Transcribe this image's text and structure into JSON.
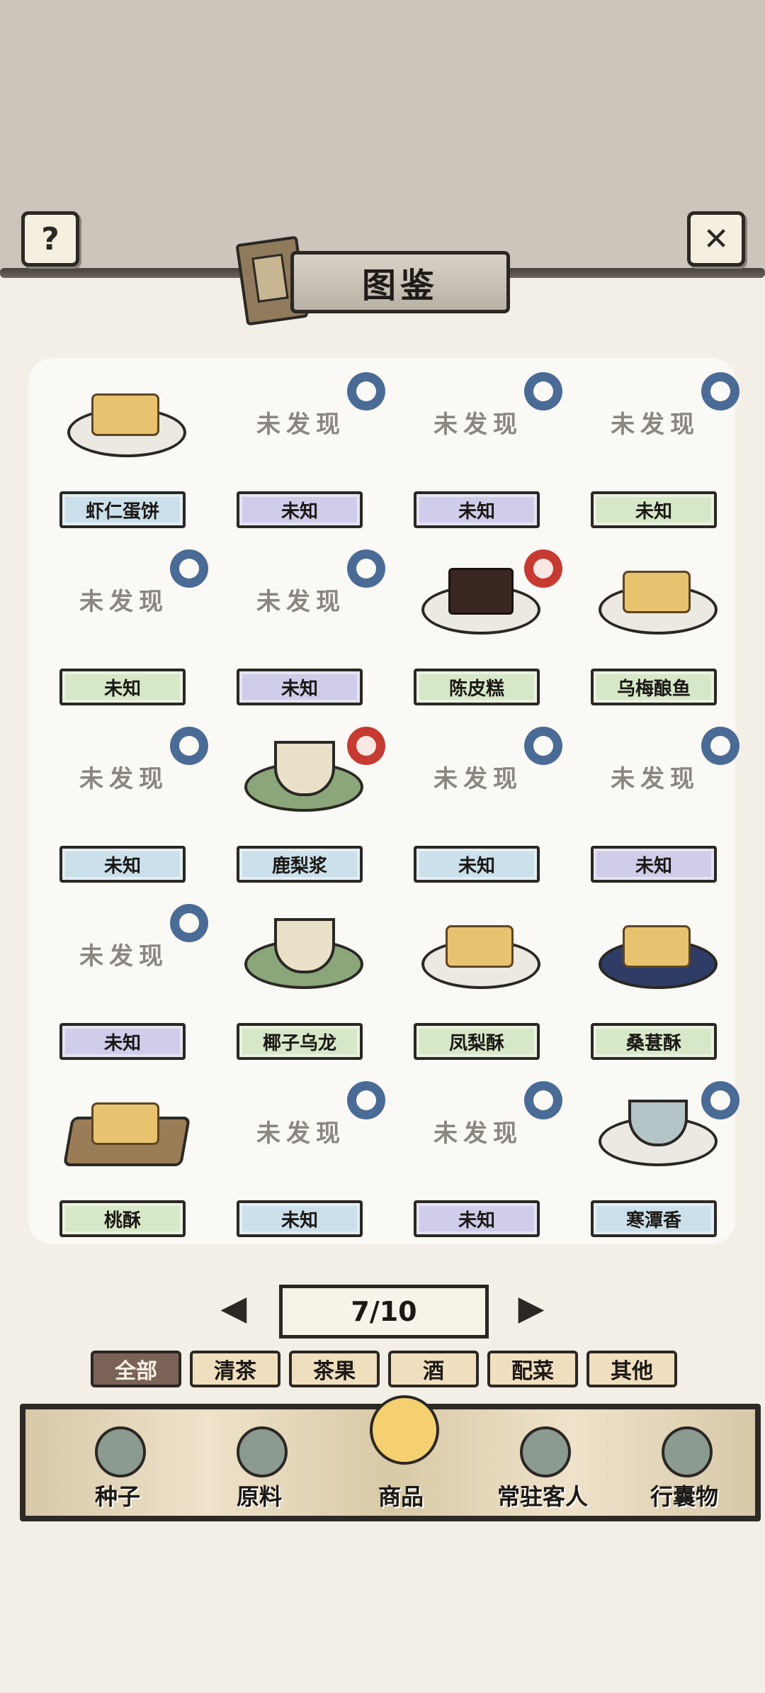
{
  "title": "图鉴",
  "page_indicator": "7/10",
  "categories": [
    {
      "label": "全部",
      "active": true
    },
    {
      "label": "清茶",
      "active": false
    },
    {
      "label": "茶果",
      "active": false
    },
    {
      "label": "酒",
      "active": false
    },
    {
      "label": "配菜",
      "active": false
    },
    {
      "label": "其他",
      "active": false
    }
  ],
  "items": [
    {
      "name": "虾仁蛋饼",
      "discovered": true,
      "label_color": "blue",
      "badge": "none"
    },
    {
      "name": "未知",
      "discovered": false,
      "undiscovered_text": "未发现",
      "label_color": "purple",
      "badge": "blue"
    },
    {
      "name": "未知",
      "discovered": false,
      "undiscovered_text": "未发现",
      "label_color": "purple",
      "badge": "blue"
    },
    {
      "name": "未知",
      "discovered": false,
      "undiscovered_text": "未发现",
      "label_color": "green",
      "badge": "blue"
    },
    {
      "name": "未知",
      "discovered": false,
      "undiscovered_text": "未发现",
      "label_color": "green",
      "badge": "blue"
    },
    {
      "name": "未知",
      "discovered": false,
      "undiscovered_text": "未发现",
      "label_color": "purple",
      "badge": "blue"
    },
    {
      "name": "陈皮糕",
      "discovered": true,
      "label_color": "green",
      "badge": "red"
    },
    {
      "name": "乌梅酿鱼",
      "discovered": true,
      "label_color": "green",
      "badge": "none"
    },
    {
      "name": "未知",
      "discovered": false,
      "undiscovered_text": "未发现",
      "label_color": "blue",
      "badge": "blue"
    },
    {
      "name": "鹿梨浆",
      "discovered": true,
      "label_color": "blue",
      "badge": "red"
    },
    {
      "name": "未知",
      "discovered": false,
      "undiscovered_text": "未发现",
      "label_color": "blue",
      "badge": "blue"
    },
    {
      "name": "未知",
      "discovered": false,
      "undiscovered_text": "未发现",
      "label_color": "purple",
      "badge": "blue"
    },
    {
      "name": "未知",
      "discovered": false,
      "undiscovered_text": "未发现",
      "label_color": "purple",
      "badge": "blue"
    },
    {
      "name": "椰子乌龙",
      "discovered": true,
      "label_color": "green",
      "badge": "none"
    },
    {
      "name": "凤梨酥",
      "discovered": true,
      "label_color": "green",
      "badge": "none"
    },
    {
      "name": "桑葚酥",
      "discovered": true,
      "label_color": "green",
      "badge": "none"
    },
    {
      "name": "桃酥",
      "discovered": true,
      "label_color": "green",
      "badge": "none"
    },
    {
      "name": "未知",
      "discovered": false,
      "undiscovered_text": "未发现",
      "label_color": "blue",
      "badge": "blue"
    },
    {
      "name": "未知",
      "discovered": false,
      "undiscovered_text": "未发现",
      "label_color": "purple",
      "badge": "blue"
    },
    {
      "name": "寒潭香",
      "discovered": true,
      "label_color": "blue",
      "badge": "blue"
    }
  ],
  "bottom_nav": [
    {
      "label": "种子",
      "active": false
    },
    {
      "label": "原料",
      "active": false
    },
    {
      "label": "商品",
      "active": true
    },
    {
      "label": "常驻客人",
      "active": false
    },
    {
      "label": "行囊物",
      "active": false
    }
  ]
}
